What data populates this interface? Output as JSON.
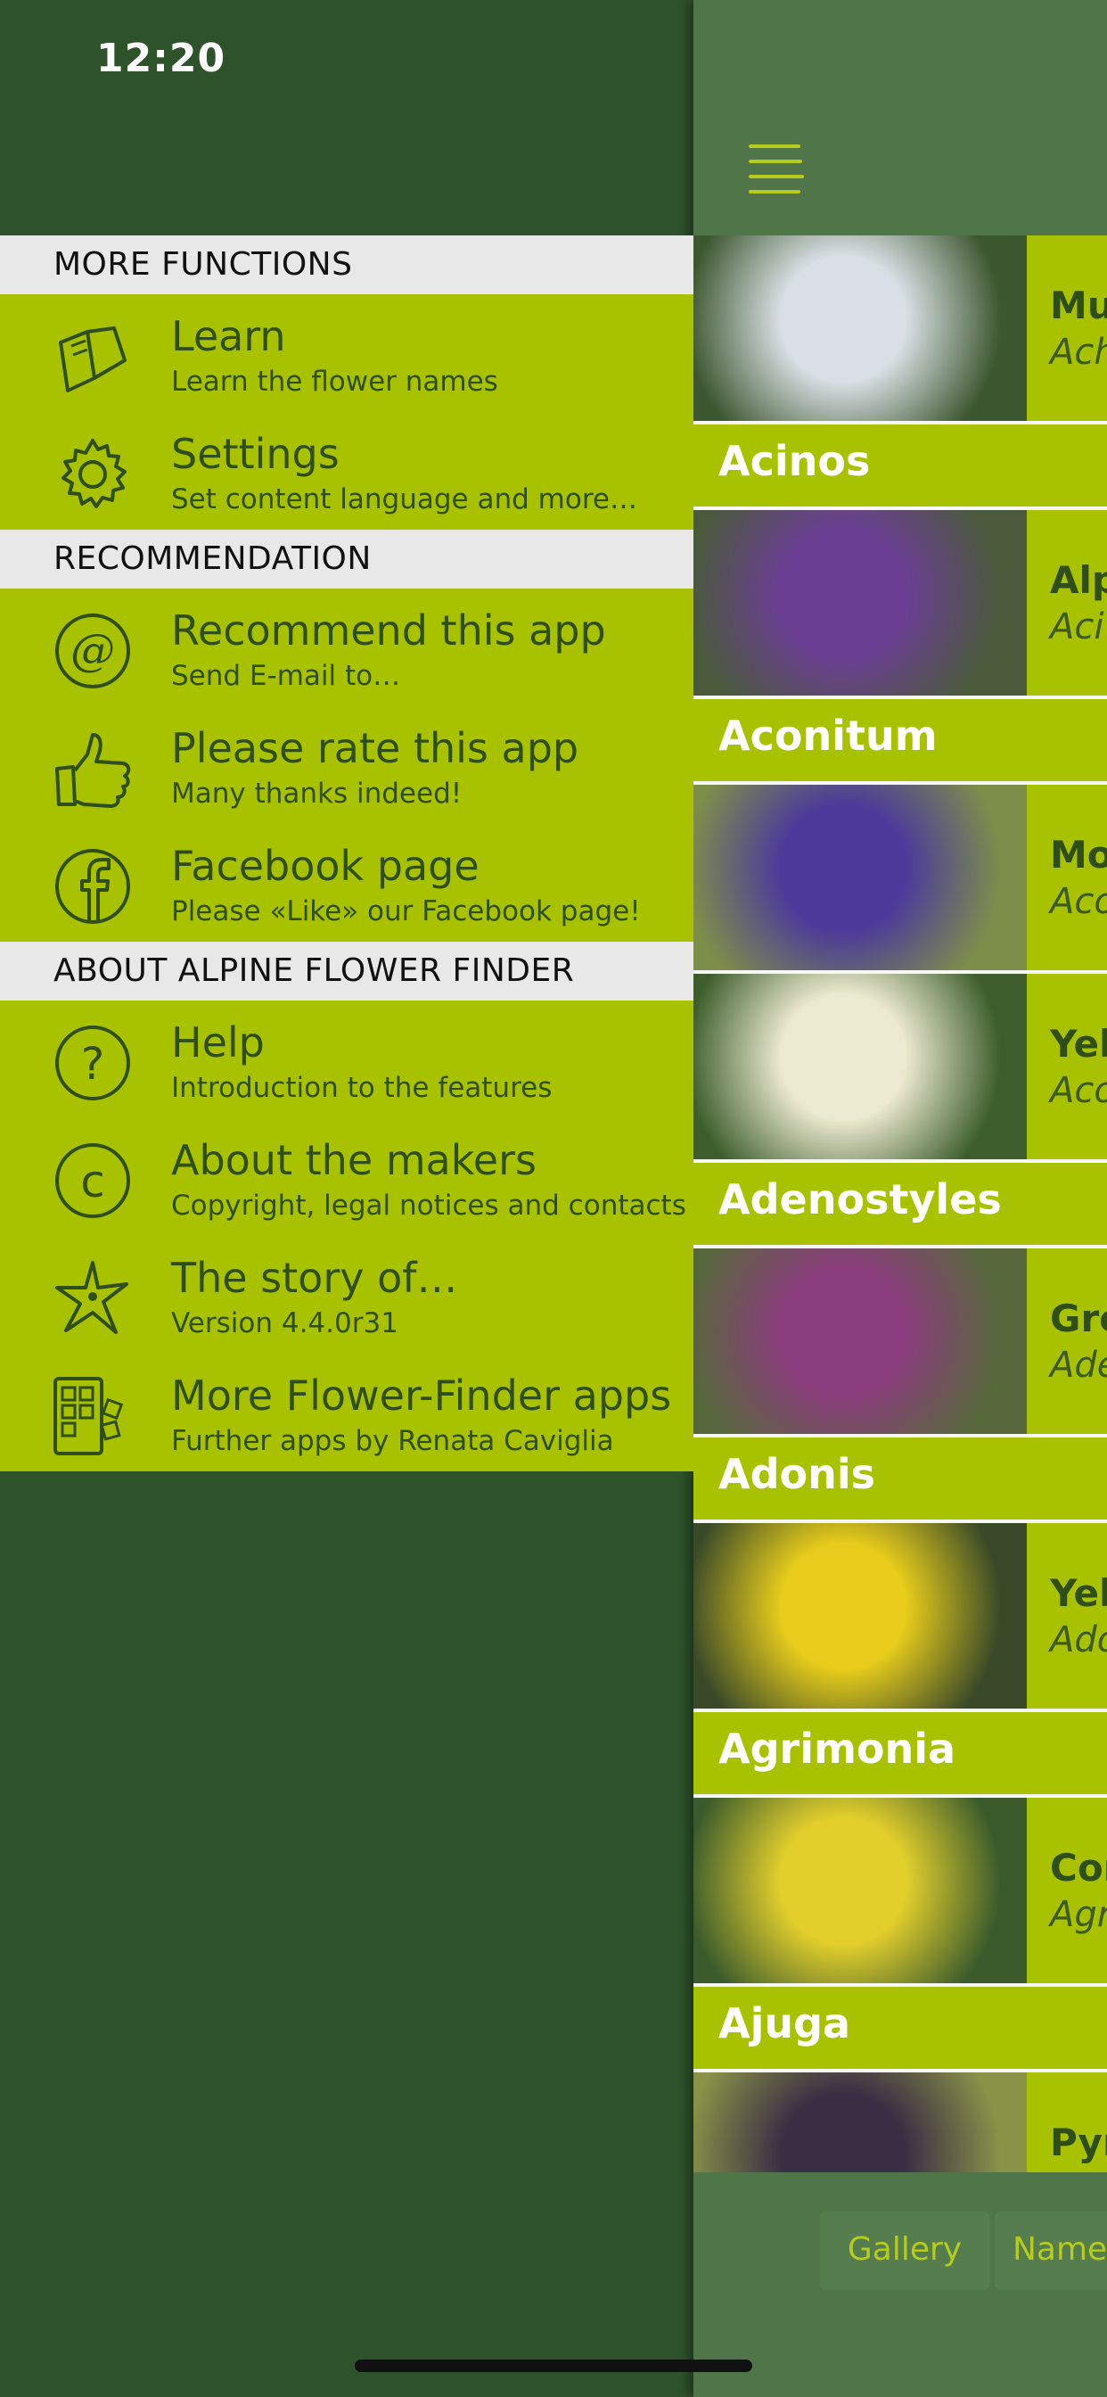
{
  "status": {
    "time": "12:20"
  },
  "side_menu": {
    "sections": [
      {
        "header": "MORE FUNCTIONS",
        "items": [
          {
            "title": "Learn",
            "subtitle": "Learn the flower names",
            "icon": "book-icon"
          },
          {
            "title": "Settings",
            "subtitle": "Set content language and more…",
            "icon": "gear-icon"
          }
        ]
      },
      {
        "header": "RECOMMENDATION",
        "items": [
          {
            "title": "Recommend this app",
            "subtitle": "Send E-mail to…",
            "icon": "at-icon"
          },
          {
            "title": "Please rate this app",
            "subtitle": "Many thanks indeed!",
            "icon": "thumbs-up-icon"
          },
          {
            "title": "Facebook page",
            "subtitle": "Please «Like» our Facebook page!",
            "icon": "facebook-icon"
          }
        ]
      },
      {
        "header": "ABOUT ALPINE FLOWER FINDER",
        "items": [
          {
            "title": "Help",
            "subtitle": "Introduction to the features",
            "icon": "help-icon"
          },
          {
            "title": "About the makers",
            "subtitle": "Copyright, legal notices and contacts",
            "icon": "copyright-icon"
          },
          {
            "title": "The story of…",
            "subtitle": "Version 4.4.0r31",
            "icon": "star-flower-icon"
          },
          {
            "title": "More Flower-Finder apps",
            "subtitle": "Further apps by Renata Caviglia",
            "icon": "apps-icon"
          }
        ]
      }
    ]
  },
  "flower_list": {
    "entries": [
      {
        "type": "flower",
        "name": "Mu",
        "latin": "Ach",
        "thumb_colors": [
          "#d9dfe4",
          "#3d5730"
        ]
      },
      {
        "type": "genus",
        "label": "Acinos"
      },
      {
        "type": "flower",
        "name": "Alp",
        "latin": "Aci",
        "thumb_colors": [
          "#6b3f94",
          "#4a5a3a"
        ]
      },
      {
        "type": "genus",
        "label": "Aconitum"
      },
      {
        "type": "flower",
        "name": "Mo",
        "latin": "Aco",
        "thumb_colors": [
          "#4c3b9a",
          "#7d8e4a"
        ]
      },
      {
        "type": "flower",
        "name": "Yel",
        "latin": "Aco",
        "thumb_colors": [
          "#ebe9cf",
          "#3d5d2c"
        ]
      },
      {
        "type": "genus",
        "label": "Adenostyles"
      },
      {
        "type": "flower",
        "name": "Gre",
        "latin": "Ade",
        "thumb_colors": [
          "#8b3e7d",
          "#56673b"
        ]
      },
      {
        "type": "genus",
        "label": "Adonis"
      },
      {
        "type": "flower",
        "name": "Yel",
        "latin": "Ado",
        "thumb_colors": [
          "#e7cc1b",
          "#3a4a28"
        ]
      },
      {
        "type": "genus",
        "label": "Agrimonia"
      },
      {
        "type": "flower",
        "name": "Cor",
        "latin": "Agr",
        "thumb_colors": [
          "#e3cf2c",
          "#3b5b2c"
        ]
      },
      {
        "type": "genus",
        "label": "Ajuga"
      },
      {
        "type": "flower",
        "name": "Pyr",
        "latin": "",
        "thumb_colors": [
          "#3b2f45",
          "#8a9248"
        ]
      }
    ]
  },
  "tabs": {
    "gallery": "Gallery",
    "names": "Name"
  },
  "colors": {
    "menu_bg": "#a8c200",
    "dark_bg": "#2e522a",
    "text": "#2f4e19"
  }
}
